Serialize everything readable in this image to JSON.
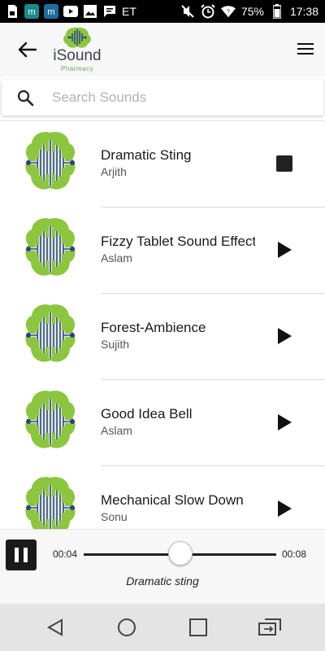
{
  "status_bar": {
    "left_icons": [
      "sim-card-icon",
      "m-app-icon",
      "m-app-icon",
      "youtube-icon",
      "gallery-icon",
      "message-icon"
    ],
    "et_label": "ET",
    "battery": "75%",
    "time": "17:38"
  },
  "header": {
    "logo_title": "iSound",
    "logo_subtitle": "Pharmacy"
  },
  "search": {
    "placeholder": "Search Sounds",
    "value": ""
  },
  "sounds": [
    {
      "title": "Dramatic Sting",
      "artist": "Arjith",
      "action": "stop"
    },
    {
      "title": "Fizzy Tablet Sound Effect",
      "artist": "Aslam",
      "action": "play"
    },
    {
      "title": "Forest-Ambience",
      "artist": "Sujith",
      "action": "play"
    },
    {
      "title": "Good Idea Bell",
      "artist": "Aslam",
      "action": "play"
    },
    {
      "title": "Mechanical Slow Down",
      "artist": "Sonu",
      "action": "play"
    }
  ],
  "player": {
    "current_time": "00:04",
    "total_time": "00:08",
    "progress": 0.5,
    "now_playing": "Dramatic sting"
  },
  "colors": {
    "brain_green": "#8cc63f",
    "waveform_blue": "#2c3e8f",
    "logo_green": "#6aa843"
  }
}
